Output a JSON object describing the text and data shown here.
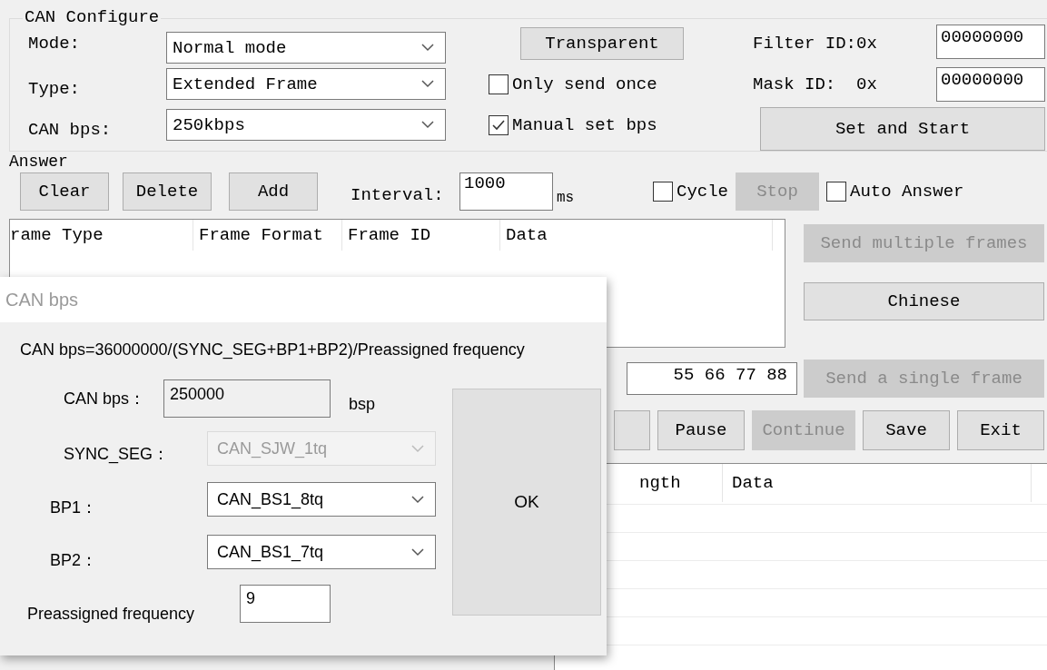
{
  "can_configure": {
    "title": "CAN Configure",
    "fields": [
      {
        "label": "Mode:",
        "value": "Normal mode"
      },
      {
        "label": "Type:",
        "value": "Extended Frame"
      },
      {
        "label": "CAN bps:",
        "value": "250kbps"
      }
    ],
    "transparent_button": "Transparent",
    "checkboxes": [
      {
        "label": "Only send once",
        "checked": false
      },
      {
        "label": "Manual set bps",
        "checked": true
      }
    ],
    "filter_id": {
      "label": "Filter ID:0x",
      "value": "00000000"
    },
    "mask_id": {
      "label": "Mask ID:  0x",
      "value": "00000000"
    },
    "set_start_button": "Set and Start"
  },
  "answer": {
    "title": "Answer",
    "buttons": [
      {
        "label": "Clear",
        "disabled": false
      },
      {
        "label": "Delete",
        "disabled": false
      },
      {
        "label": "Add",
        "disabled": false
      }
    ],
    "interval": {
      "label": "Interval:",
      "value": "1000",
      "unit": "ms"
    },
    "cycle": {
      "label": "Cycle",
      "checked": false
    },
    "stop_button": {
      "label": "Stop",
      "disabled": true
    },
    "auto_answer": {
      "label": "Auto Answer",
      "checked": false
    }
  },
  "answer_table": {
    "columns": [
      "rame Type",
      "Frame Format",
      "Frame ID",
      "Data"
    ]
  },
  "side_buttons": [
    {
      "label": "Send multiple frames",
      "disabled": true
    },
    {
      "label": "Chinese",
      "disabled": false
    }
  ],
  "data_field": {
    "value": "55 66 77 88"
  },
  "send_single_button": {
    "label": "Send a single frame",
    "disabled": true
  },
  "control_buttons": [
    {
      "label": "Pause",
      "disabled": false
    },
    {
      "label": "Continue",
      "disabled": true
    },
    {
      "label": "Save",
      "disabled": false
    },
    {
      "label": "Exit",
      "disabled": false
    }
  ],
  "receive_table": {
    "columns": [
      "ngth",
      "Data"
    ]
  },
  "dialog": {
    "title": "CAN bps",
    "formula": "CAN bps=36000000/(SYNC_SEG+BP1+BP2)/Preassigned frequency",
    "bps": {
      "label": "CAN bps：",
      "value": "250000",
      "unit": "bsp"
    },
    "selects": [
      {
        "label": "SYNC_SEG：",
        "value": "CAN_SJW_1tq",
        "disabled": true
      },
      {
        "label": "BP1：",
        "value": "CAN_BS1_8tq",
        "disabled": false
      },
      {
        "label": "BP2：",
        "value": "CAN_BS1_7tq",
        "disabled": false
      }
    ],
    "frequency": {
      "label": "Preassigned frequency",
      "value": "9"
    },
    "ok_button": "OK"
  }
}
